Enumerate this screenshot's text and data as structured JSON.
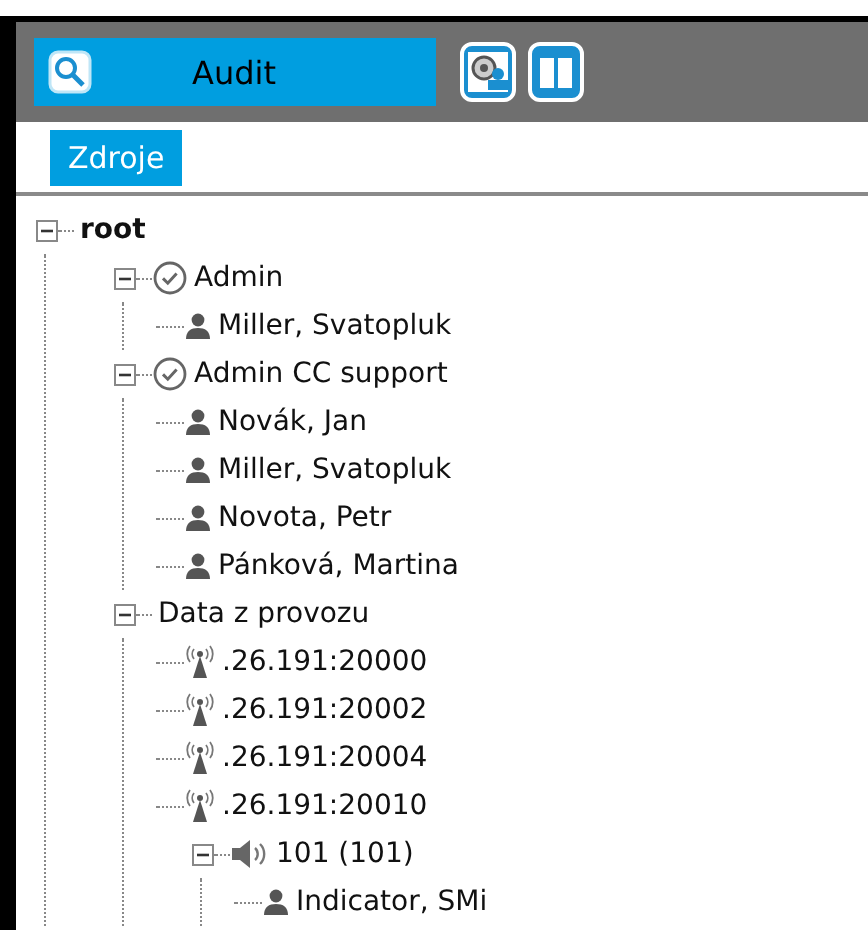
{
  "toolbar": {
    "audit_button": "Audit",
    "buttons": [
      {
        "kind": "person"
      },
      {
        "kind": "book"
      }
    ]
  },
  "tabs": [
    {
      "label": "Zdroje",
      "selected": true
    }
  ],
  "tree": [
    {
      "label": "root",
      "bold": true,
      "expanded": true,
      "children": [
        {
          "label": "Admin",
          "kind": "group",
          "expanded": true,
          "children": [
            {
              "label": "Miller, Svatopluk",
              "kind": "user"
            }
          ]
        },
        {
          "label": "Admin CC support",
          "kind": "group",
          "expanded": true,
          "children": [
            {
              "label": "Novák, Jan",
              "kind": "user"
            },
            {
              "label": "Miller, Svatopluk",
              "kind": "user"
            },
            {
              "label": "Novota, Petr",
              "kind": "user"
            },
            {
              "label": "Pánková, Martina",
              "kind": "user"
            }
          ]
        },
        {
          "label": "Data z provozu",
          "expanded": true,
          "children": [
            {
              "label": ".26.191:20000",
              "kind": "antenna"
            },
            {
              "label": ".26.191:20002",
              "kind": "antenna"
            },
            {
              "label": ".26.191:20004",
              "kind": "antenna"
            },
            {
              "label": ".26.191:20010",
              "kind": "antenna"
            },
            {
              "label": "101 (101)",
              "kind": "speaker",
              "expanded": true,
              "children": [
                {
                  "label": "Indicator, SMi",
                  "kind": "user"
                }
              ]
            }
          ]
        }
      ]
    }
  ]
}
